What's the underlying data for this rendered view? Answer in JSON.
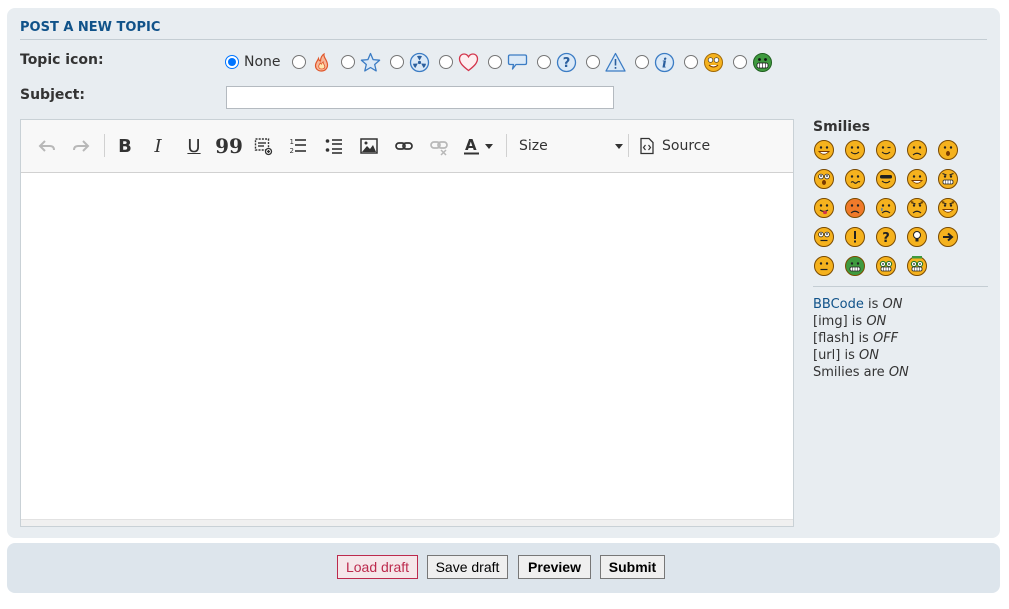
{
  "panel_title": "POST A NEW TOPIC",
  "topic_icon": {
    "label": "Topic icon:",
    "none_label": "None",
    "selected": "None",
    "icons": [
      "fire-icon",
      "star-icon",
      "radioactive-icon",
      "heart-icon",
      "speech-bubble-icon",
      "question-icon",
      "warning-icon",
      "info-icon",
      "mrgreen-face-icon",
      "green-grin-icon"
    ]
  },
  "subject": {
    "label": "Subject:",
    "value": ""
  },
  "toolbar": {
    "bold": "B",
    "italic": "I",
    "underline": "U",
    "quote": "99",
    "size_label": "Size",
    "source_label": "Source"
  },
  "smilies": {
    "title": "Smilies",
    "items": [
      "very-happy",
      "smile",
      "wink",
      "sad",
      "surprised",
      "shocked",
      "confused",
      "cool",
      "laughing",
      "mad",
      "razz",
      "embarrassed",
      "crying",
      "evil",
      "twisted-evil",
      "rolling-eyes",
      "exclamation",
      "question",
      "idea",
      "arrow",
      "neutral",
      "mr-green",
      "geek",
      "uber-geek"
    ]
  },
  "status": {
    "bbcode_link": "BBCode",
    "bbcode_text": " is ",
    "bbcode_value": "ON",
    "img_label": "[img] is ",
    "img_value": "ON",
    "flash_label": "[flash] is ",
    "flash_value": "OFF",
    "url_label": "[url] is ",
    "url_value": "ON",
    "smilies_label": "Smilies are ",
    "smilies_value": "ON"
  },
  "buttons": {
    "load_draft": "Load draft",
    "save_draft": "Save draft",
    "preview": "Preview",
    "submit": "Submit"
  }
}
